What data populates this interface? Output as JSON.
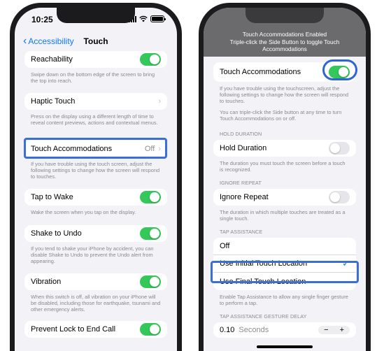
{
  "left_phone": {
    "status_time": "10:25",
    "nav": {
      "back_label": "Accessibility",
      "title": "Touch"
    },
    "reachability": {
      "label": "Reachability",
      "on": true,
      "footer": "Swipe down on the bottom edge of the screen to bring the top into reach."
    },
    "haptic": {
      "label": "Haptic Touch",
      "footer": "Press on the display using a different length of time to reveal content previews, actions and contextual menus."
    },
    "touch_acc": {
      "label": "Touch Accommodations",
      "value": "Off",
      "footer": "If you have trouble using the touch screen, adjust the following settings to change how the screen will respond to touches."
    },
    "tap_to_wake": {
      "label": "Tap to Wake",
      "on": true,
      "footer": "Wake the screen when you tap on the display."
    },
    "shake_undo": {
      "label": "Shake to Undo",
      "on": true,
      "footer": "If you tend to shake your iPhone by accident, you can disable Shake to Undo to prevent the Undo alert from appearing."
    },
    "vibration": {
      "label": "Vibration",
      "on": true,
      "footer": "When this switch is off, all vibration on your iPhone will be disabled, including those for earthquake, tsunami and other emergency alerts."
    },
    "prevent_lock": {
      "label": "Prevent Lock to End Call",
      "on": true
    }
  },
  "right_phone": {
    "banner_line1": "Touch Accommodations Enabled",
    "banner_line2": "Triple-click the Side Button to toggle Touch Accommodations",
    "touch_acc": {
      "label": "Touch Accommodations",
      "on": true,
      "footer1": "If you have trouble using the touchscreen, adjust the following settings to change how the screen will respond to touches.",
      "footer2": "You can triple-click the Side button at any time to turn Touch Accommodations on or off."
    },
    "hold_duration": {
      "header": "HOLD DURATION",
      "label": "Hold Duration",
      "on": false,
      "footer": "The duration you must touch the screen before a touch is recognized."
    },
    "ignore_repeat": {
      "header": "IGNORE REPEAT",
      "label": "Ignore Repeat",
      "on": false,
      "footer": "The duration in which multiple touches are treated as a single touch."
    },
    "tap_assistance": {
      "header": "TAP ASSISTANCE",
      "options": [
        "Off",
        "Use Initial Touch Location",
        "Use Final Touch Location"
      ],
      "selected": "Use Initial Touch Location",
      "footer": "Enable Tap Assistance to allow any single finger gesture to perform a tap."
    },
    "gesture_delay_header": "TAP ASSISTANCE GESTURE DELAY",
    "gesture_delay_value": "0.10",
    "gesture_delay_unit": "Seconds",
    "stepper_minus": "−",
    "stepper_plus": "+"
  },
  "colors": {
    "accent_blue": "#0a7aff",
    "toggle_green": "#34c759",
    "highlight": "#3b6fd6"
  }
}
